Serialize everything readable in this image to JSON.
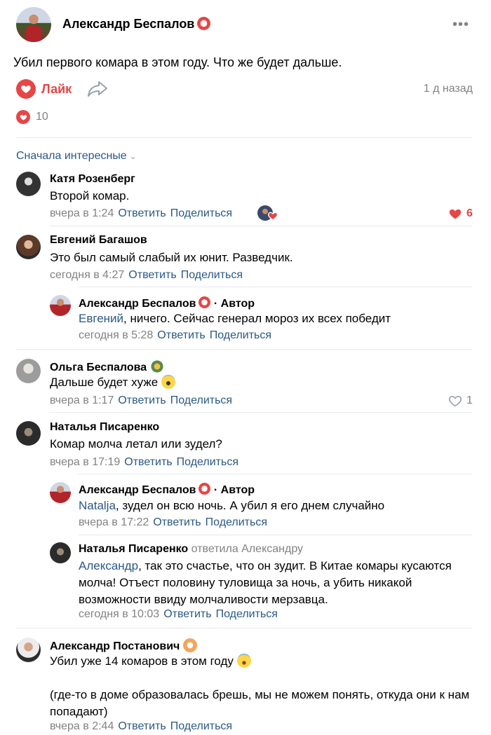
{
  "post": {
    "author": "Александр Беспалов",
    "text": "Убил первого комара в этом году. Что же будет дальше.",
    "like_label": "Лайк",
    "time": "1 д назад",
    "likes_count": "10"
  },
  "comments_sort": "Сначала интересные",
  "comments": [
    {
      "name": "Катя Розенберг",
      "text": "Второй комар.",
      "time": "вчера в 1:24",
      "reply": "Ответить",
      "share": "Поделиться",
      "likes": "6"
    },
    {
      "name": "Евгений Багашов",
      "text": "Это был самый слабый их юнит. Разведчик.",
      "time": "сегодня в 4:27",
      "reply": "Ответить",
      "share": "Поделиться"
    },
    {
      "name": "Александр Беспалов",
      "author_tag": "· Автор",
      "mention": "Евгений",
      "text": ", ничего. Сейчас генерал мороз их всех победит",
      "time": "сегодня в 5:28",
      "reply": "Ответить",
      "share": "Поделиться"
    },
    {
      "name": "Ольга Беспалова",
      "text": "Дальше будет хуже",
      "time": "вчера в 1:17",
      "reply": "Ответить",
      "share": "Поделиться",
      "likes": "1"
    },
    {
      "name": "Наталья Писаренко",
      "text": "Комар молча летал или зудел?",
      "time": "вчера в 17:19",
      "reply": "Ответить",
      "share": "Поделиться"
    },
    {
      "name": "Александр Беспалов",
      "author_tag": "· Автор",
      "mention": "Natalja",
      "text": ", зудел он всю ночь. А убил я его днем случайно",
      "time": "вчера в 17:22",
      "reply": "Ответить",
      "share": "Поделиться"
    },
    {
      "name": "Наталья Писаренко",
      "replied_to": "ответила Александру",
      "mention": "Александр",
      "text_line1": ", так это счастье, что он зудит. В Китае комары кусаются",
      "text_line2": "молча! Отъест половину туловища за ночь, а убить никакой",
      "text_line3": "возможности ввиду молчаливости мерзавца.",
      "time": "сегодня в 10:03",
      "reply": "Ответить",
      "share": "Поделиться"
    },
    {
      "name": "Александр Постанович",
      "text_line1": "Убил уже 14 комаров в этом году",
      "text_line2": "(где-то в доме образовалась брешь, мы не можем понять, откуда они к нам",
      "text_line3": "попадают)",
      "time": "вчера в 2:44",
      "reply": "Ответить",
      "share": "Поделиться"
    }
  ],
  "colors": {
    "accent": "#2a5885",
    "like_red": "#e64646",
    "secondary_text": "#828282",
    "divider": "#e7e8ec"
  }
}
